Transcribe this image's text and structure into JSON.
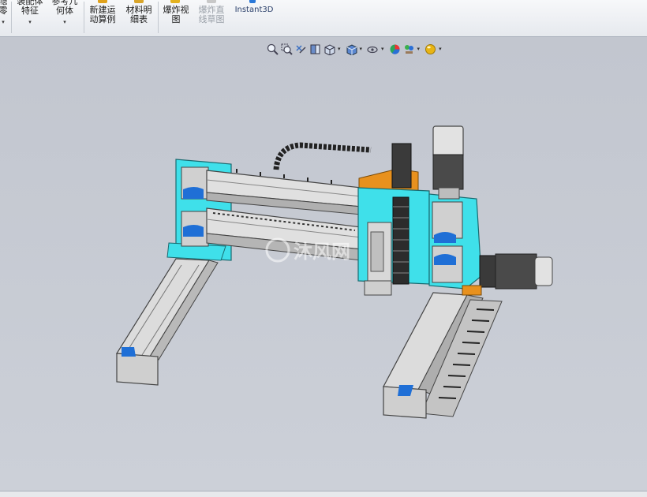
{
  "ribbon": {
    "partial_left_1": "隐",
    "partial_left_2": "零",
    "assembly_feature": [
      "装配体",
      "特征"
    ],
    "reference_geometry": [
      "参考几",
      "何体"
    ],
    "new_motion_study": [
      "新建运",
      "动算例"
    ],
    "bill_of_materials": [
      "材料明",
      "细表"
    ],
    "exploded_view": [
      "爆炸视",
      "图"
    ],
    "explode_line_sketch": [
      "爆炸直",
      "线草图"
    ],
    "instant3d": "Instant3D"
  },
  "heads_up_toolbar": {
    "icons": [
      "zoom-to-fit-icon",
      "zoom-to-area-icon",
      "previous-view-icon",
      "section-view-icon",
      "view-orientation-icon",
      "display-style-icon",
      "hide-show-items-icon",
      "edit-appearance-icon",
      "apply-scene-icon",
      "view-settings-icon"
    ]
  },
  "watermark": {
    "text": "沐风网"
  },
  "colors": {
    "accent_cyan": "#3fe0ea",
    "orange_bracket": "#e8911e",
    "blue_caps": "#1f6fd6",
    "rail_gray": "#d8d8d8"
  }
}
